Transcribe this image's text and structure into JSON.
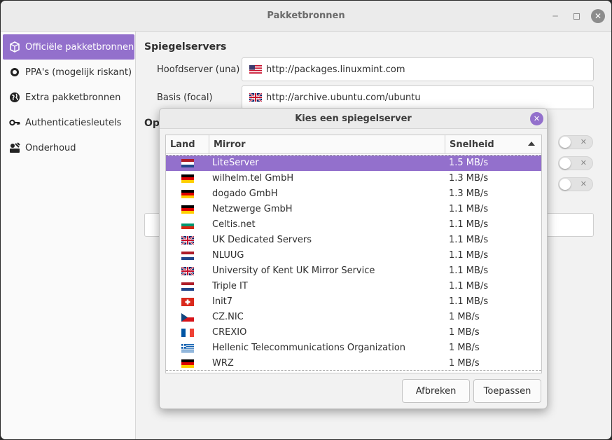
{
  "window": {
    "title": "Pakketbronnen"
  },
  "sidebar": {
    "items": [
      {
        "label": "Officiële pakketbronnen",
        "icon": "package-icon",
        "active": true
      },
      {
        "label": "PPA's (mogelijk riskant)",
        "icon": "ppa-icon",
        "active": false
      },
      {
        "label": "Extra pakketbronnen",
        "icon": "globe-icon",
        "active": false
      },
      {
        "label": "Authenticatiesleutels",
        "icon": "key-icon",
        "active": false
      },
      {
        "label": "Onderhoud",
        "icon": "maintenance-icon",
        "active": false
      }
    ]
  },
  "main": {
    "heading": "Spiegelservers",
    "main_label": "Hoofdserver (una)",
    "main_value": "http://packages.linuxmint.com",
    "main_flag": "us",
    "base_label": "Basis (focal)",
    "base_value": "http://archive.ubuntu.com/ubuntu",
    "base_flag": "gb",
    "options_heading_partial": "Op"
  },
  "dialog": {
    "title": "Kies een spiegelserver",
    "columns": {
      "land": "Land",
      "mirror": "Mirror",
      "speed": "Snelheid"
    },
    "cancel_label": "Afbreken",
    "apply_label": "Toepassen",
    "rows": [
      {
        "flag": "nl",
        "name": "LiteServer",
        "speed": "1.5 MB/s",
        "selected": true
      },
      {
        "flag": "de",
        "name": "wilhelm.tel GmbH",
        "speed": "1.3 MB/s"
      },
      {
        "flag": "de",
        "name": "dogado GmbH",
        "speed": "1.3 MB/s"
      },
      {
        "flag": "de",
        "name": "Netzwerge GmbH",
        "speed": "1.1 MB/s"
      },
      {
        "flag": "bg",
        "name": "Celtis.net",
        "speed": "1.1 MB/s"
      },
      {
        "flag": "gb",
        "name": "UK Dedicated Servers",
        "speed": "1.1 MB/s"
      },
      {
        "flag": "nl",
        "name": "NLUUG",
        "speed": "1.1 MB/s"
      },
      {
        "flag": "gb",
        "name": "University of Kent UK Mirror Service",
        "speed": "1.1 MB/s"
      },
      {
        "flag": "nl",
        "name": "Triple IT",
        "speed": "1.1 MB/s"
      },
      {
        "flag": "ch",
        "name": "Init7",
        "speed": "1.1 MB/s"
      },
      {
        "flag": "cz",
        "name": "CZ.NIC",
        "speed": "1 MB/s"
      },
      {
        "flag": "fr",
        "name": "CREXIO",
        "speed": "1 MB/s"
      },
      {
        "flag": "gr",
        "name": "Hellenic Telecommunications Organization",
        "speed": "1 MB/s"
      },
      {
        "flag": "de",
        "name": "WRZ",
        "speed": "1 MB/s"
      }
    ]
  },
  "colors": {
    "accent": "#9370cc"
  }
}
